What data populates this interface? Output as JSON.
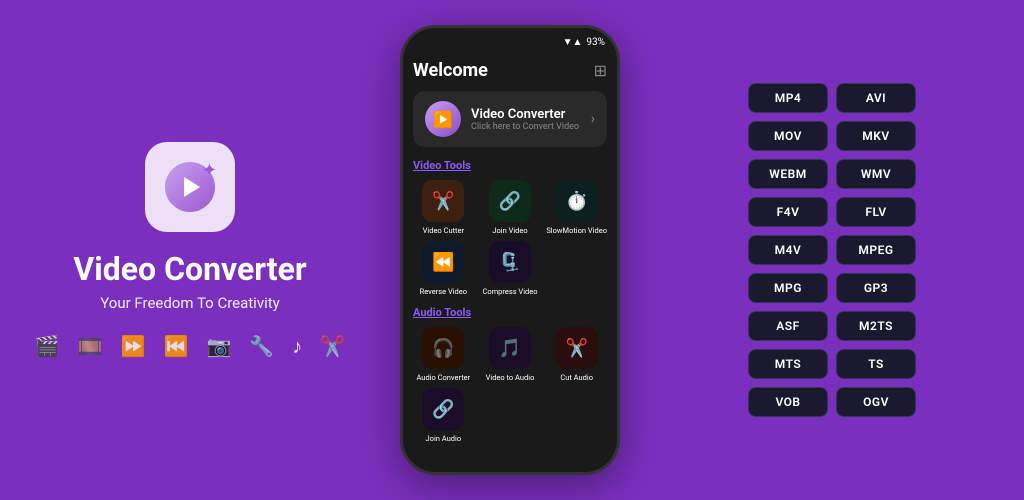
{
  "app": {
    "title": "Video Converter",
    "subtitle": "Your Freedom To Creativity"
  },
  "phone": {
    "welcome_title": "Welcome",
    "status_signal": "▼▲",
    "status_battery": "93%",
    "converter_banner": {
      "title": "Video Converter",
      "subtitle": "Click here to Convert Video"
    },
    "video_tools_label": "Video Tools",
    "audio_tools_label": "Audio Tools",
    "video_tools": [
      {
        "label": "Video Cutter",
        "icon": "✂️",
        "color_class": "icon-brown"
      },
      {
        "label": "Join Video",
        "icon": "🔗",
        "color_class": "icon-dark-green"
      },
      {
        "label": "SlowMotion Video",
        "icon": "⏱️",
        "color_class": "icon-dark-teal"
      },
      {
        "label": "Reverse Video",
        "icon": "⏪",
        "color_class": "icon-dark-blue"
      },
      {
        "label": "Compress Video",
        "icon": "🗜️",
        "color_class": "icon-dark-purple"
      }
    ],
    "audio_tools": [
      {
        "label": "Audio Converter",
        "icon": "🎧",
        "color_class": "audio-icon-orange"
      },
      {
        "label": "Video to Audio",
        "icon": "🎵",
        "color_class": "audio-icon-purple"
      },
      {
        "label": "Cut Audio",
        "icon": "✂️",
        "color_class": "audio-icon-dark-red"
      },
      {
        "label": "Join Audio",
        "icon": "🔗",
        "color_class": "icon-dark-purple"
      }
    ]
  },
  "formats": [
    "MP4",
    "AVI",
    "MOV",
    "MKV",
    "WEBM",
    "WMV",
    "F4V",
    "FLV",
    "M4V",
    "MPEG",
    "MPG",
    "GP3",
    "ASF",
    "M2TS",
    "MTS",
    "TS",
    "VOB",
    "OGV"
  ],
  "feature_icons": [
    "🎬",
    "🎞️",
    "⏩",
    "⏮️",
    "📷",
    "⛏️",
    "♪",
    "✂️"
  ],
  "ui": {
    "accent_color": "#7B2FBE",
    "dark_bg": "#1a1a1a",
    "card_bg": "#2a2a2a"
  }
}
